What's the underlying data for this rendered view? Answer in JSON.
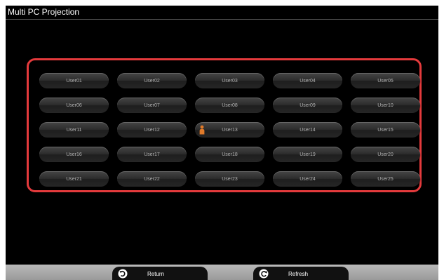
{
  "window": {
    "title": "Multi PC Projection"
  },
  "users": [
    {
      "label": "User01",
      "presenting": false
    },
    {
      "label": "User02",
      "presenting": false
    },
    {
      "label": "User03",
      "presenting": false
    },
    {
      "label": "User04",
      "presenting": false
    },
    {
      "label": "User05",
      "presenting": false
    },
    {
      "label": "User06",
      "presenting": false
    },
    {
      "label": "User07",
      "presenting": false
    },
    {
      "label": "User08",
      "presenting": false
    },
    {
      "label": "User09",
      "presenting": false
    },
    {
      "label": "User10",
      "presenting": false
    },
    {
      "label": "User11",
      "presenting": false
    },
    {
      "label": "User12",
      "presenting": false
    },
    {
      "label": "User13",
      "presenting": true
    },
    {
      "label": "User14",
      "presenting": false
    },
    {
      "label": "User15",
      "presenting": false
    },
    {
      "label": "User16",
      "presenting": false
    },
    {
      "label": "User17",
      "presenting": false
    },
    {
      "label": "User18",
      "presenting": false
    },
    {
      "label": "User19",
      "presenting": false
    },
    {
      "label": "User20",
      "presenting": false
    },
    {
      "label": "User21",
      "presenting": false
    },
    {
      "label": "User22",
      "presenting": false
    },
    {
      "label": "User23",
      "presenting": false
    },
    {
      "label": "User24",
      "presenting": false
    },
    {
      "label": "User25",
      "presenting": false
    }
  ],
  "toolbar": {
    "return_label": "Return",
    "return_icon": "return-icon",
    "refresh_label": "Refresh",
    "refresh_icon": "refresh-icon"
  },
  "colors": {
    "highlight": "#e43a3c",
    "presenter_icon": "#e07a2a",
    "background": "#000000",
    "toolbar": "#a8a8a8"
  },
  "icons": {
    "presenter": "presenter-person-icon"
  }
}
